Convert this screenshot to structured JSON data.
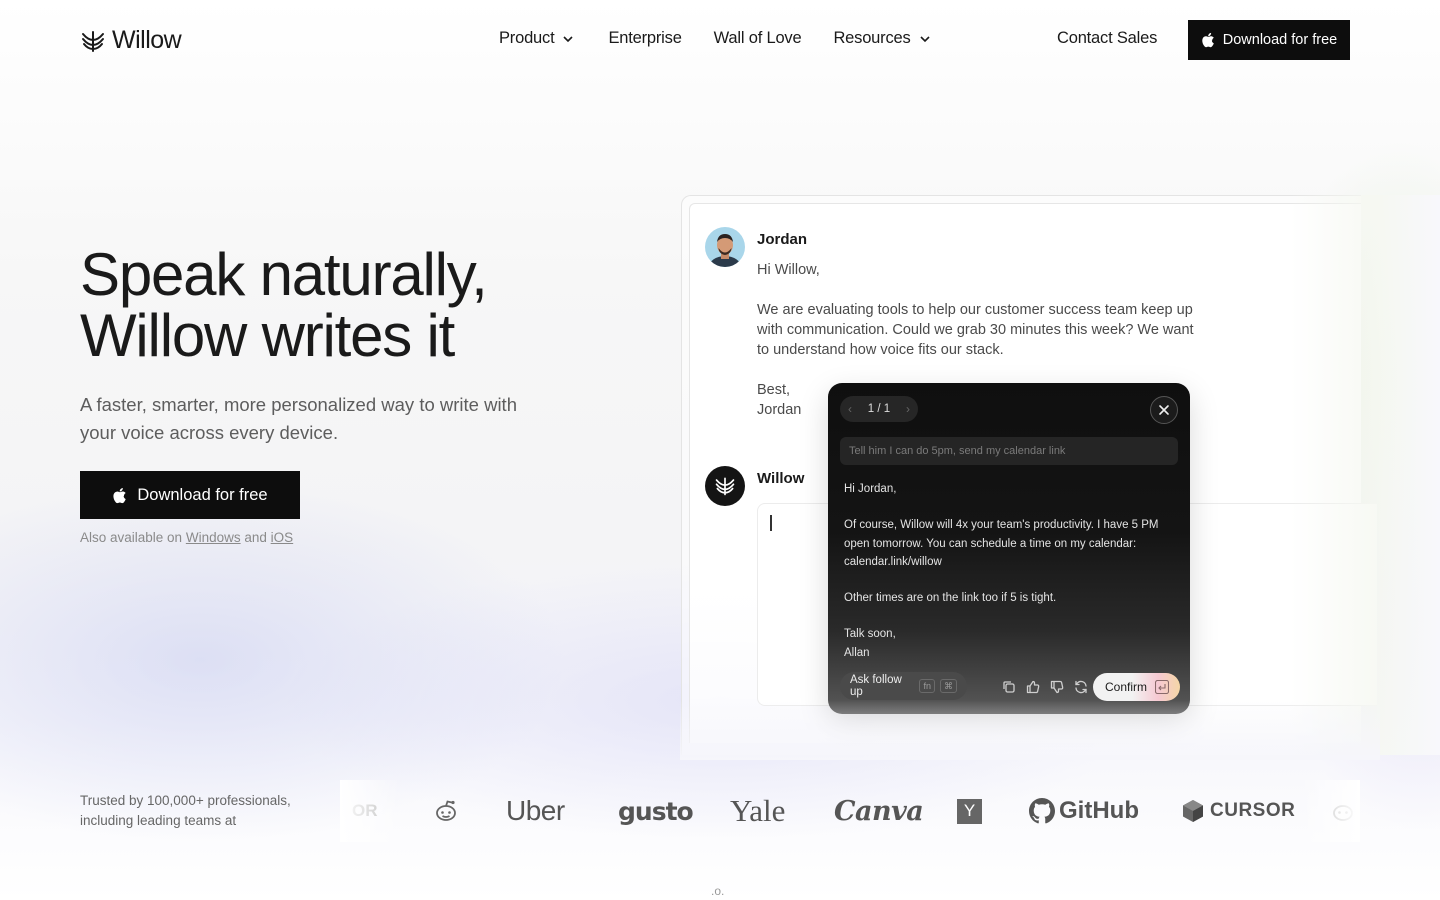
{
  "nav": {
    "logo_text": "Willow",
    "links": [
      "Product",
      "Enterprise",
      "Wall of Love",
      "Resources"
    ],
    "contact": "Contact Sales",
    "download": "Download for free"
  },
  "hero": {
    "title_line1": "Speak naturally,",
    "title_line2": "Willow writes it",
    "subtitle": "A faster, smarter, more personalized way to write with your voice across every device.",
    "cta": "Download for free",
    "also_prefix": "Also available on",
    "also_windows": "Windows",
    "also_and": "and",
    "also_ios": "iOS"
  },
  "mock": {
    "sender": "Jordan",
    "email_greeting": "Hi Willow,",
    "email_body": "We are evaluating tools to help our customer success team keep up with communication. Could we grab 30 minutes this week? We want to understand how voice fits our stack.",
    "email_signoff": "Best,",
    "email_sign_name": "Jordan",
    "willow_name": "Willow",
    "popup": {
      "pager": "1 / 1",
      "prompt": "Tell him I can do 5pm, send my calendar link",
      "greeting": "Hi Jordan,",
      "para1": "Of course, Willow will 4x your team's productivity. I have 5 PM open tomorrow. You can schedule a time on my calendar: calendar.link/willow",
      "para2": "Other times are on the link too if 5 is tight.",
      "closing": "Talk soon,",
      "name": "Allan",
      "ask": "Ask follow up",
      "ask_key1": "fn",
      "ask_key2": "⌘",
      "confirm": "Confirm"
    }
  },
  "trusted": {
    "text": "Trusted by 100,000+ professionals, including leading teams at",
    "logos": [
      "Uber",
      "gusto",
      "Yale",
      "Canva",
      "Y",
      "GitHub",
      "CURSOR"
    ],
    "cut_left": "OR"
  },
  "footer_dots": ".o."
}
